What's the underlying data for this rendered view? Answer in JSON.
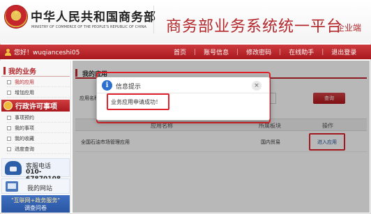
{
  "header": {
    "org_name_cn": "中华人民共和国商务部",
    "org_name_en": "MINISTRY OF COMMERCE OF THE PEOPLE'S REPUBLIC OF CHINA",
    "platform_title": "商务部业务系统统一平台",
    "platform_subtitle": "企业端"
  },
  "navbar": {
    "greeting": "您好！wuqianceshi05",
    "links": [
      "首页",
      "账号信息",
      "修改密码",
      "在线助手",
      "退出登录"
    ],
    "separator": "|"
  },
  "sidebar": {
    "section1_title": "我的业务",
    "section1_items": [
      {
        "label": "我的应用",
        "active": true
      },
      {
        "label": "增加应用",
        "active": false
      }
    ],
    "section2_title": "行政许可事项",
    "section2_items": [
      {
        "label": "事项预约"
      },
      {
        "label": "我的事项"
      },
      {
        "label": "我的收藏"
      },
      {
        "label": "进度查询"
      }
    ],
    "service_phone_label": "客服电话",
    "service_phone_number": "010-67870108",
    "website_label": "我的网站",
    "survey_line1": "\"互联网+政务服务\"",
    "survey_line2": "调查问卷"
  },
  "main": {
    "title": "我的应用",
    "search_label": "应用名称",
    "search_button": "查询",
    "columns": [
      "应用名称",
      "所属板块",
      "操作"
    ],
    "rows": [
      {
        "name": "全国石油市场管理应用",
        "board": "国内贸易",
        "action": "进入应用"
      }
    ]
  },
  "modal": {
    "title": "信息提示",
    "message": "业务应用申请成功！",
    "close_glyph": "×",
    "info_glyph": "i"
  },
  "colors": {
    "brand_red": "#b3262a",
    "highlight_red": "#e0232a",
    "info_blue": "#2b6fd0"
  }
}
